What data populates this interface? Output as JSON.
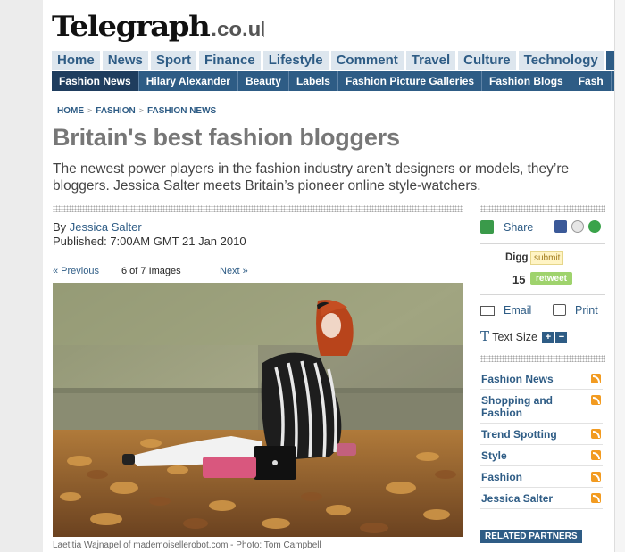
{
  "site": {
    "logo": "Telegraph",
    "logo_suffix": ".co.uk"
  },
  "nav_primary": [
    "Home",
    "News",
    "Sport",
    "Finance",
    "Lifestyle",
    "Comment",
    "Travel",
    "Culture",
    "Technology"
  ],
  "nav_secondary": [
    "Fashion News",
    "Hilary Alexander",
    "Beauty",
    "Labels",
    "Fashion Picture Galleries",
    "Fashion Blogs",
    "Fash"
  ],
  "breadcrumb": [
    "HOME",
    "FASHION",
    "FASHION NEWS"
  ],
  "article": {
    "title": "Britain's best fashion bloggers",
    "standfirst": "The newest power players in the fashion industry aren’t designers or models, they’re bloggers. Jessica Salter meets Britain’s pioneer online style-watchers.",
    "by_prefix": "By",
    "author": "Jessica Salter",
    "published": "Published: 7:00AM GMT 21 Jan 2010"
  },
  "gallery": {
    "prev": "« Previous",
    "count": "6 of 7 Images",
    "next": "Next »",
    "caption": "Laetitia Wajnapel of mademoisellerobot.com - Photo: Tom Campbell"
  },
  "sidebar": {
    "share": "Share",
    "digg_label": "Digg",
    "digg_submit": "submit",
    "digg_count": "15",
    "retweet": "retweet",
    "email": "Email",
    "print": "Print",
    "text_size": "Text Size",
    "links": [
      "Fashion News",
      "Shopping and Fashion",
      "Trend Spotting",
      "Style",
      "Fashion",
      "Jessica Salter"
    ],
    "related_partners": "RELATED PARTNERS"
  },
  "colors": {
    "brand_blue": "#2e5c85",
    "nav_light": "#dde6ee",
    "rss": "#f29b21",
    "retweet": "#9fd36d"
  }
}
